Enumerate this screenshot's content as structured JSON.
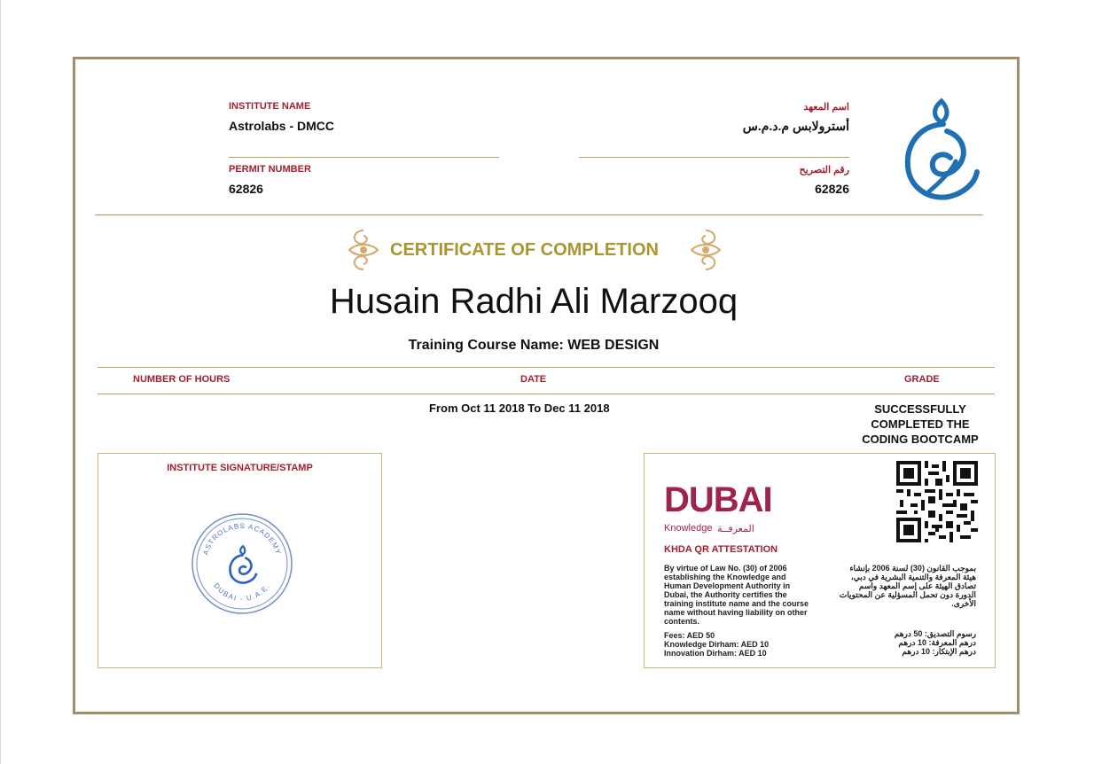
{
  "header": {
    "institute_name_label": "INSTITUTE NAME",
    "institute_name": "Astrolabs - DMCC",
    "institute_name_label_ar": "اسم المعهد",
    "institute_name_ar": "أسترولابس م.د.م.س",
    "permit_label": "PERMIT NUMBER",
    "permit_number": "62826",
    "permit_label_ar": "رقم التصريح",
    "permit_number_ar": "62826"
  },
  "certificate": {
    "title": "CERTIFICATE OF COMPLETION",
    "recipient": "Husain Radhi Ali Marzooq",
    "course": "Training Course Name: WEB DESIGN"
  },
  "details": {
    "hours_label": "NUMBER OF HOURS",
    "date_label": "DATE",
    "grade_label": "GRADE",
    "date_value": "From Oct 11 2018 To Dec 11 2018",
    "grade_value": "SUCCESSFULLY COMPLETED THE CODING BOOTCAMP"
  },
  "signature": {
    "label": "INSTITUTE SIGNATURE/STAMP",
    "stamp_top_text": "ASTROLABS ACADEMY",
    "stamp_bottom_text": "DUBAI - U.A.E."
  },
  "khda": {
    "logo_text": "DUBAI",
    "logo_sub": "Knowledge",
    "logo_sub_ar": "المعرفــة",
    "title": "KHDA QR ATTESTATION",
    "text_en": "By virtue of Law No. (30) of 2006 establishing the Knowledge and Human Development Authority in Dubai, the Authority certifies the training institute name and the course name without having liability on other contents.",
    "fees": "Fees: AED 50",
    "knowledge_dirham": "Knowledge Dirham: AED 10",
    "innovation_dirham": "Innovation Dirham: AED 10",
    "text_ar": "بموجب القانون (30) لسنة 2006 بإنشاء هيئة المعرفة والتنمية البشرية في دبي، تصادق الهيئة على إسم المعهد واسم الدورة دون تحمل المسؤلية عن المحتويات الأخرى.",
    "fees_ar": "رسوم التصديق: 50 درهم",
    "knowledge_dirham_ar": "درهم المعرفة: 10 درهم",
    "innovation_dirham_ar": "درهم الإبتكار: 10 درهم"
  },
  "colors": {
    "accent_red": "#a21f2e",
    "gold": "#a99531",
    "frame": "#a08d6a",
    "logo_blue": "#1f6fb5",
    "dubai_maroon": "#a0234b"
  }
}
